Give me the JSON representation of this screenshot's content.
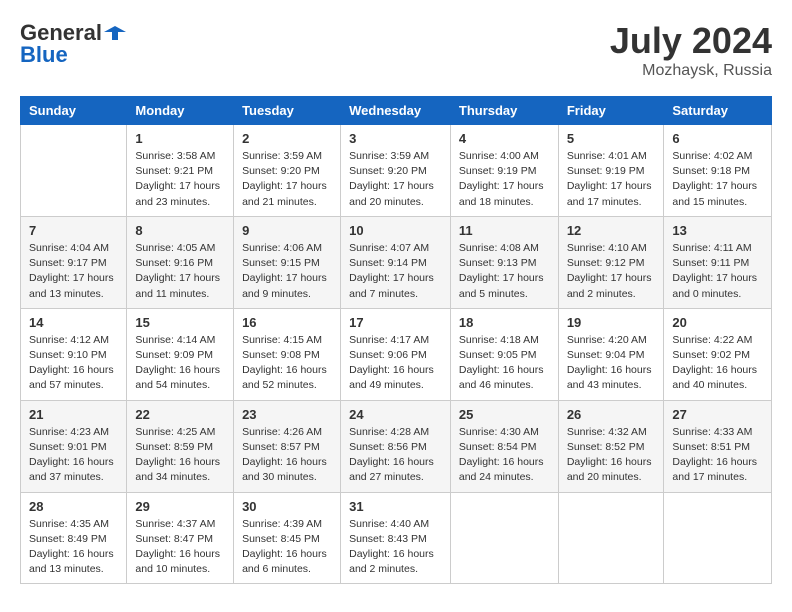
{
  "header": {
    "logo_general": "General",
    "logo_blue": "Blue",
    "month_year": "July 2024",
    "location": "Mozhaysk, Russia"
  },
  "days_of_week": [
    "Sunday",
    "Monday",
    "Tuesday",
    "Wednesday",
    "Thursday",
    "Friday",
    "Saturday"
  ],
  "weeks": [
    [
      {
        "day": "",
        "sunrise": "",
        "sunset": "",
        "daylight": ""
      },
      {
        "day": "1",
        "sunrise": "Sunrise: 3:58 AM",
        "sunset": "Sunset: 9:21 PM",
        "daylight": "Daylight: 17 hours and 23 minutes."
      },
      {
        "day": "2",
        "sunrise": "Sunrise: 3:59 AM",
        "sunset": "Sunset: 9:20 PM",
        "daylight": "Daylight: 17 hours and 21 minutes."
      },
      {
        "day": "3",
        "sunrise": "Sunrise: 3:59 AM",
        "sunset": "Sunset: 9:20 PM",
        "daylight": "Daylight: 17 hours and 20 minutes."
      },
      {
        "day": "4",
        "sunrise": "Sunrise: 4:00 AM",
        "sunset": "Sunset: 9:19 PM",
        "daylight": "Daylight: 17 hours and 18 minutes."
      },
      {
        "day": "5",
        "sunrise": "Sunrise: 4:01 AM",
        "sunset": "Sunset: 9:19 PM",
        "daylight": "Daylight: 17 hours and 17 minutes."
      },
      {
        "day": "6",
        "sunrise": "Sunrise: 4:02 AM",
        "sunset": "Sunset: 9:18 PM",
        "daylight": "Daylight: 17 hours and 15 minutes."
      }
    ],
    [
      {
        "day": "7",
        "sunrise": "Sunrise: 4:04 AM",
        "sunset": "Sunset: 9:17 PM",
        "daylight": "Daylight: 17 hours and 13 minutes."
      },
      {
        "day": "8",
        "sunrise": "Sunrise: 4:05 AM",
        "sunset": "Sunset: 9:16 PM",
        "daylight": "Daylight: 17 hours and 11 minutes."
      },
      {
        "day": "9",
        "sunrise": "Sunrise: 4:06 AM",
        "sunset": "Sunset: 9:15 PM",
        "daylight": "Daylight: 17 hours and 9 minutes."
      },
      {
        "day": "10",
        "sunrise": "Sunrise: 4:07 AM",
        "sunset": "Sunset: 9:14 PM",
        "daylight": "Daylight: 17 hours and 7 minutes."
      },
      {
        "day": "11",
        "sunrise": "Sunrise: 4:08 AM",
        "sunset": "Sunset: 9:13 PM",
        "daylight": "Daylight: 17 hours and 5 minutes."
      },
      {
        "day": "12",
        "sunrise": "Sunrise: 4:10 AM",
        "sunset": "Sunset: 9:12 PM",
        "daylight": "Daylight: 17 hours and 2 minutes."
      },
      {
        "day": "13",
        "sunrise": "Sunrise: 4:11 AM",
        "sunset": "Sunset: 9:11 PM",
        "daylight": "Daylight: 17 hours and 0 minutes."
      }
    ],
    [
      {
        "day": "14",
        "sunrise": "Sunrise: 4:12 AM",
        "sunset": "Sunset: 9:10 PM",
        "daylight": "Daylight: 16 hours and 57 minutes."
      },
      {
        "day": "15",
        "sunrise": "Sunrise: 4:14 AM",
        "sunset": "Sunset: 9:09 PM",
        "daylight": "Daylight: 16 hours and 54 minutes."
      },
      {
        "day": "16",
        "sunrise": "Sunrise: 4:15 AM",
        "sunset": "Sunset: 9:08 PM",
        "daylight": "Daylight: 16 hours and 52 minutes."
      },
      {
        "day": "17",
        "sunrise": "Sunrise: 4:17 AM",
        "sunset": "Sunset: 9:06 PM",
        "daylight": "Daylight: 16 hours and 49 minutes."
      },
      {
        "day": "18",
        "sunrise": "Sunrise: 4:18 AM",
        "sunset": "Sunset: 9:05 PM",
        "daylight": "Daylight: 16 hours and 46 minutes."
      },
      {
        "day": "19",
        "sunrise": "Sunrise: 4:20 AM",
        "sunset": "Sunset: 9:04 PM",
        "daylight": "Daylight: 16 hours and 43 minutes."
      },
      {
        "day": "20",
        "sunrise": "Sunrise: 4:22 AM",
        "sunset": "Sunset: 9:02 PM",
        "daylight": "Daylight: 16 hours and 40 minutes."
      }
    ],
    [
      {
        "day": "21",
        "sunrise": "Sunrise: 4:23 AM",
        "sunset": "Sunset: 9:01 PM",
        "daylight": "Daylight: 16 hours and 37 minutes."
      },
      {
        "day": "22",
        "sunrise": "Sunrise: 4:25 AM",
        "sunset": "Sunset: 8:59 PM",
        "daylight": "Daylight: 16 hours and 34 minutes."
      },
      {
        "day": "23",
        "sunrise": "Sunrise: 4:26 AM",
        "sunset": "Sunset: 8:57 PM",
        "daylight": "Daylight: 16 hours and 30 minutes."
      },
      {
        "day": "24",
        "sunrise": "Sunrise: 4:28 AM",
        "sunset": "Sunset: 8:56 PM",
        "daylight": "Daylight: 16 hours and 27 minutes."
      },
      {
        "day": "25",
        "sunrise": "Sunrise: 4:30 AM",
        "sunset": "Sunset: 8:54 PM",
        "daylight": "Daylight: 16 hours and 24 minutes."
      },
      {
        "day": "26",
        "sunrise": "Sunrise: 4:32 AM",
        "sunset": "Sunset: 8:52 PM",
        "daylight": "Daylight: 16 hours and 20 minutes."
      },
      {
        "day": "27",
        "sunrise": "Sunrise: 4:33 AM",
        "sunset": "Sunset: 8:51 PM",
        "daylight": "Daylight: 16 hours and 17 minutes."
      }
    ],
    [
      {
        "day": "28",
        "sunrise": "Sunrise: 4:35 AM",
        "sunset": "Sunset: 8:49 PM",
        "daylight": "Daylight: 16 hours and 13 minutes."
      },
      {
        "day": "29",
        "sunrise": "Sunrise: 4:37 AM",
        "sunset": "Sunset: 8:47 PM",
        "daylight": "Daylight: 16 hours and 10 minutes."
      },
      {
        "day": "30",
        "sunrise": "Sunrise: 4:39 AM",
        "sunset": "Sunset: 8:45 PM",
        "daylight": "Daylight: 16 hours and 6 minutes."
      },
      {
        "day": "31",
        "sunrise": "Sunrise: 4:40 AM",
        "sunset": "Sunset: 8:43 PM",
        "daylight": "Daylight: 16 hours and 2 minutes."
      },
      {
        "day": "",
        "sunrise": "",
        "sunset": "",
        "daylight": ""
      },
      {
        "day": "",
        "sunrise": "",
        "sunset": "",
        "daylight": ""
      },
      {
        "day": "",
        "sunrise": "",
        "sunset": "",
        "daylight": ""
      }
    ]
  ]
}
